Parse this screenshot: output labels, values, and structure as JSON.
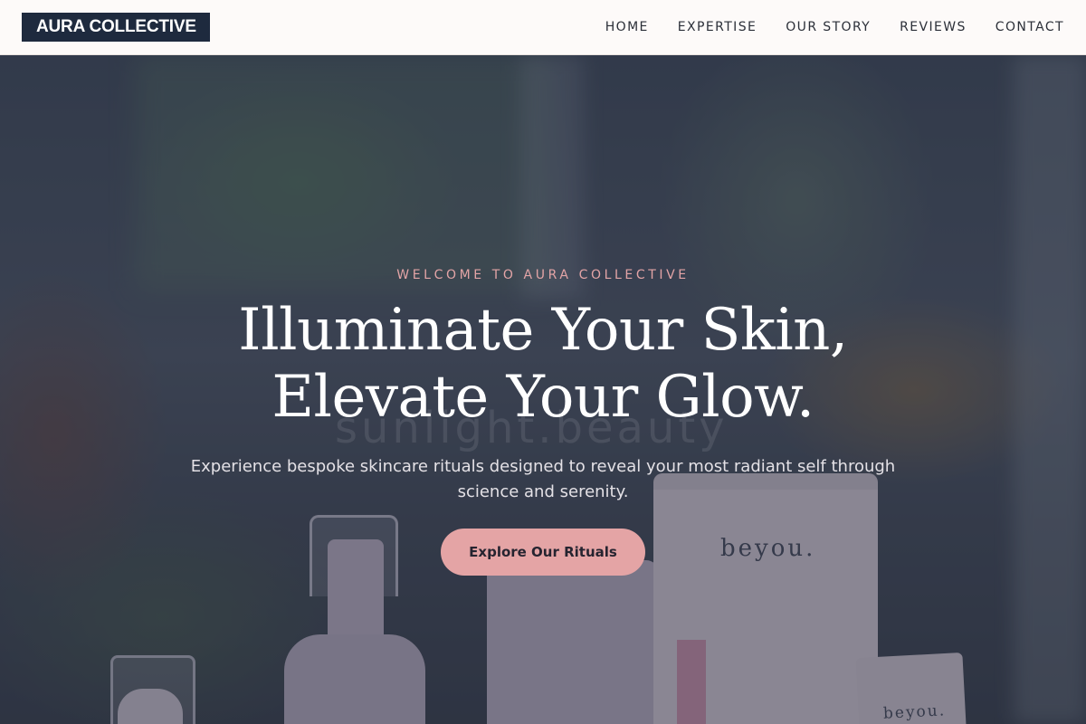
{
  "brand": {
    "name": "AURA COLLECTIVE",
    "logo_bg": "#1e2a3e"
  },
  "nav": {
    "items": [
      {
        "label": "HOME"
      },
      {
        "label": "EXPERTISE"
      },
      {
        "label": "OUR STORY"
      },
      {
        "label": "REVIEWS"
      },
      {
        "label": "CONTACT"
      }
    ]
  },
  "hero": {
    "eyebrow": "WELCOME TO AURA COLLECTIVE",
    "headline_line1": "Illuminate Your Skin,",
    "headline_line2": "Elevate Your Glow.",
    "subtext": "Experience bespoke skincare rituals designed to reveal your most radiant self through science and serenity.",
    "cta_label": "Explore Our Rituals",
    "accent_color": "#e4a4a5",
    "image": {
      "watermark_text": "sunlight.beauty",
      "product_logo": "beyou.",
      "product_logo_small": "beyou."
    }
  }
}
